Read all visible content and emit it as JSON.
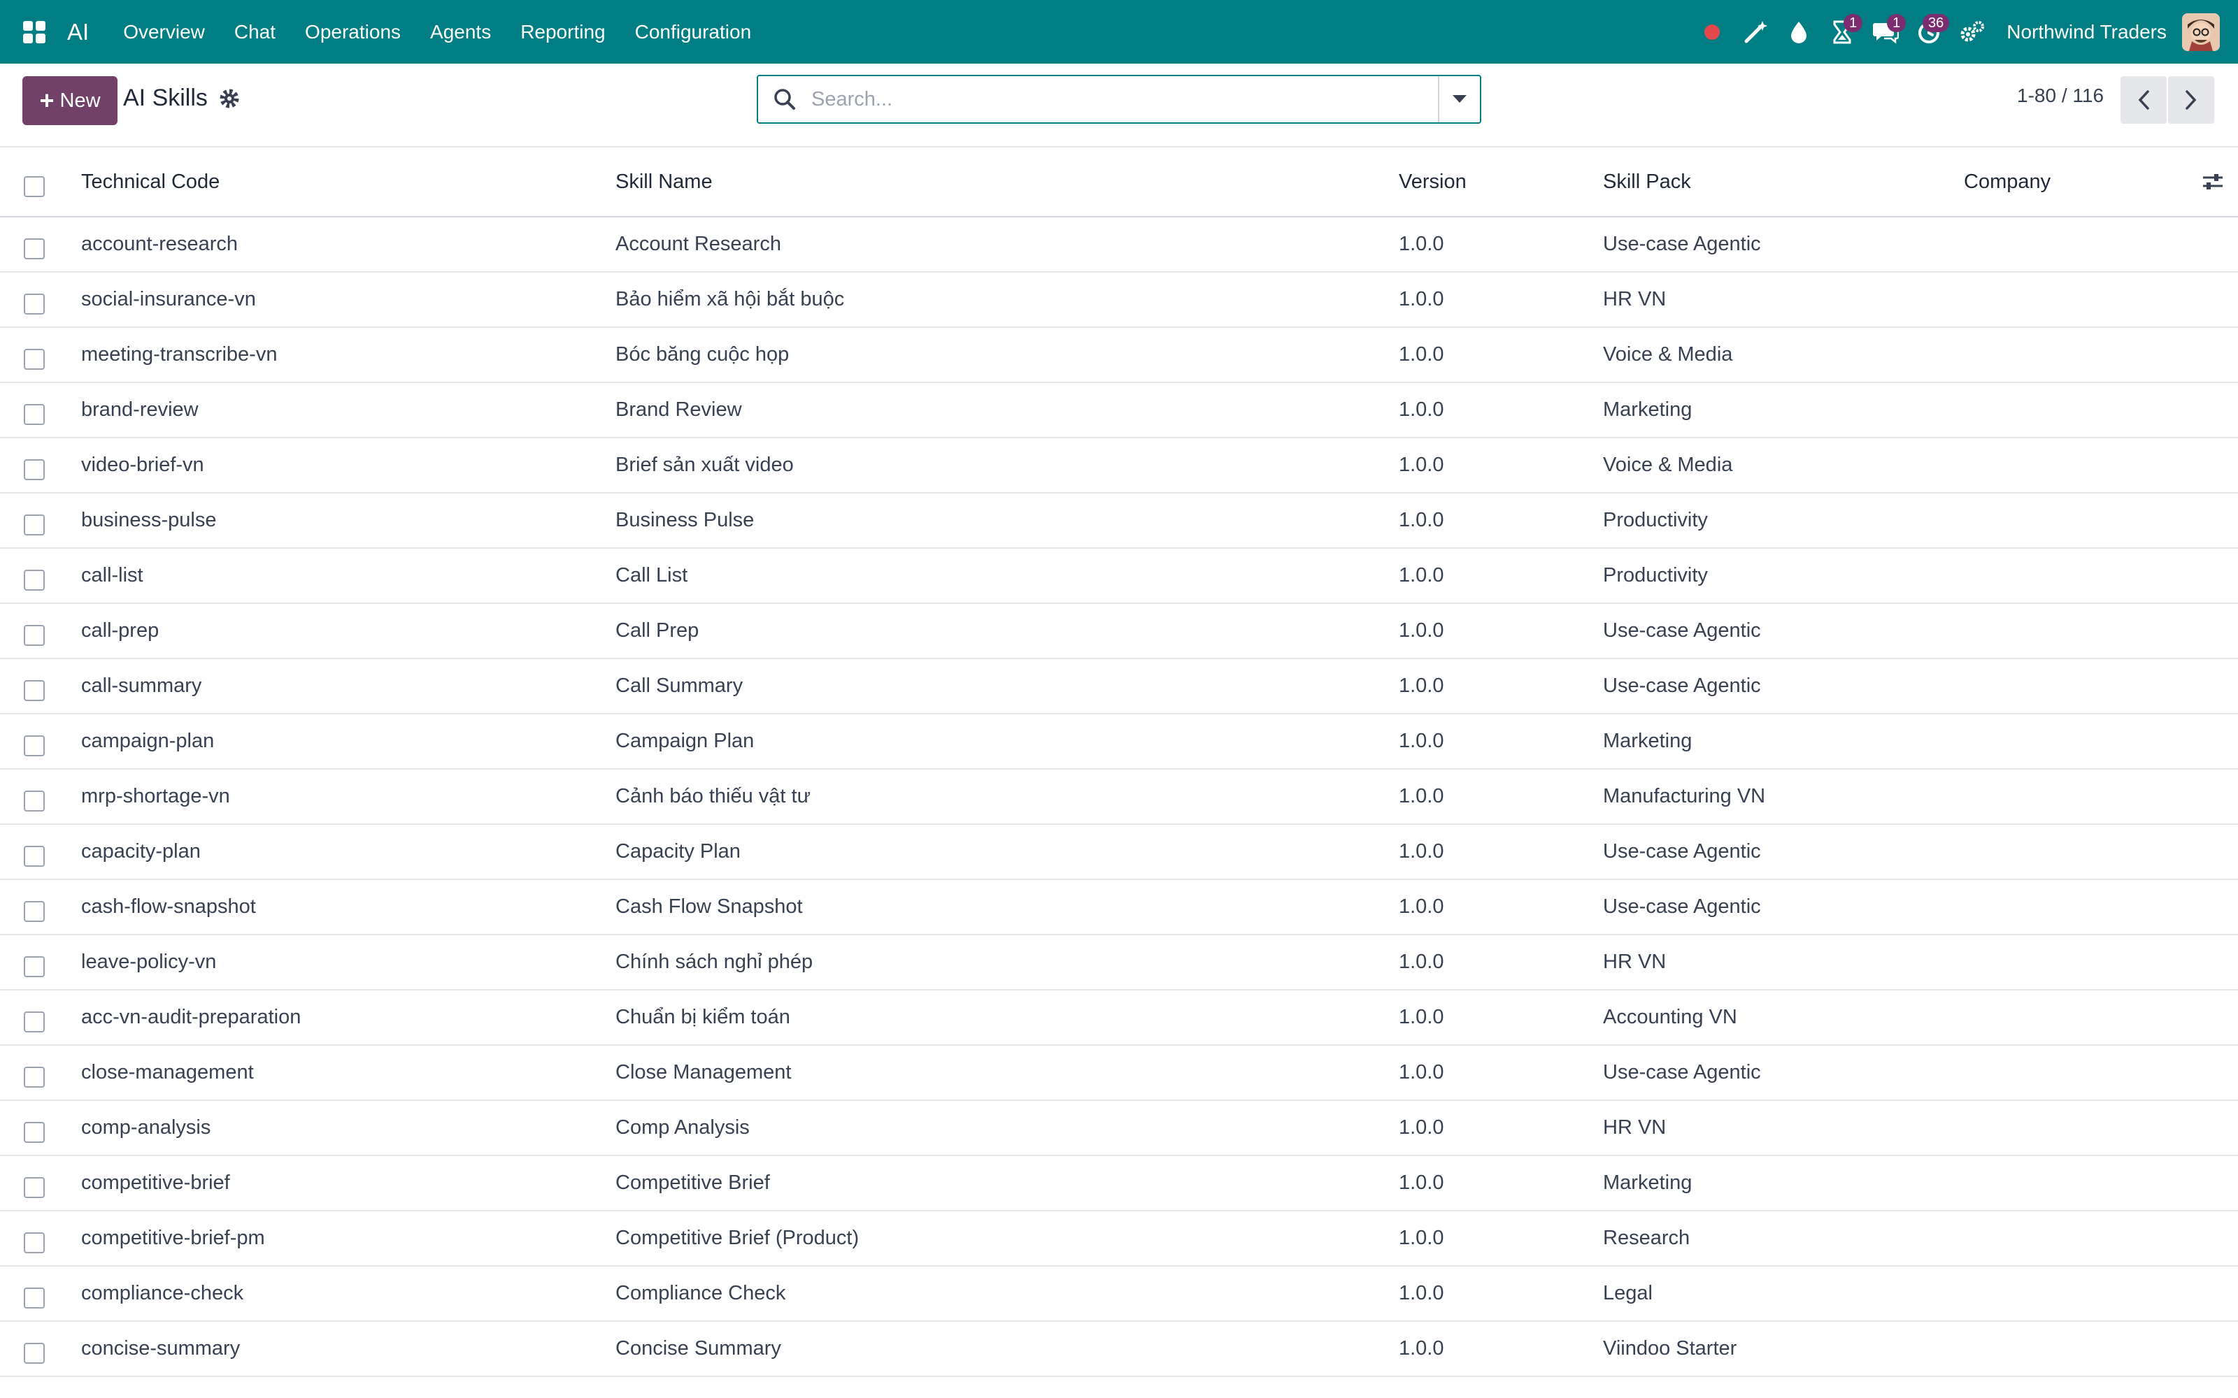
{
  "navbar": {
    "brand": "AI",
    "menu": [
      "Overview",
      "Chat",
      "Operations",
      "Agents",
      "Reporting",
      "Configuration"
    ],
    "activities_badge": "1",
    "messages_badge": "1",
    "timer_badge": "36",
    "company": "Northwind Traders"
  },
  "control": {
    "new_label": "New",
    "title": "AI Skills",
    "search_placeholder": "Search...",
    "pager": "1-80 / 116"
  },
  "table": {
    "headers": {
      "code": "Technical Code",
      "name": "Skill Name",
      "version": "Version",
      "pack": "Skill Pack",
      "company": "Company"
    },
    "rows": [
      {
        "code": "account-research",
        "name": "Account Research",
        "version": "1.0.0",
        "pack": "Use-case Agentic"
      },
      {
        "code": "social-insurance-vn",
        "name": "Bảo hiểm xã hội bắt buộc",
        "version": "1.0.0",
        "pack": "HR VN"
      },
      {
        "code": "meeting-transcribe-vn",
        "name": "Bóc băng cuộc họp",
        "version": "1.0.0",
        "pack": "Voice & Media"
      },
      {
        "code": "brand-review",
        "name": "Brand Review",
        "version": "1.0.0",
        "pack": "Marketing"
      },
      {
        "code": "video-brief-vn",
        "name": "Brief sản xuất video",
        "version": "1.0.0",
        "pack": "Voice & Media"
      },
      {
        "code": "business-pulse",
        "name": "Business Pulse",
        "version": "1.0.0",
        "pack": "Productivity"
      },
      {
        "code": "call-list",
        "name": "Call List",
        "version": "1.0.0",
        "pack": "Productivity"
      },
      {
        "code": "call-prep",
        "name": "Call Prep",
        "version": "1.0.0",
        "pack": "Use-case Agentic"
      },
      {
        "code": "call-summary",
        "name": "Call Summary",
        "version": "1.0.0",
        "pack": "Use-case Agentic"
      },
      {
        "code": "campaign-plan",
        "name": "Campaign Plan",
        "version": "1.0.0",
        "pack": "Marketing"
      },
      {
        "code": "mrp-shortage-vn",
        "name": "Cảnh báo thiếu vật tư",
        "version": "1.0.0",
        "pack": "Manufacturing VN"
      },
      {
        "code": "capacity-plan",
        "name": "Capacity Plan",
        "version": "1.0.0",
        "pack": "Use-case Agentic"
      },
      {
        "code": "cash-flow-snapshot",
        "name": "Cash Flow Snapshot",
        "version": "1.0.0",
        "pack": "Use-case Agentic"
      },
      {
        "code": "leave-policy-vn",
        "name": "Chính sách nghỉ phép",
        "version": "1.0.0",
        "pack": "HR VN"
      },
      {
        "code": "acc-vn-audit-preparation",
        "name": "Chuẩn bị kiểm toán",
        "version": "1.0.0",
        "pack": "Accounting VN"
      },
      {
        "code": "close-management",
        "name": "Close Management",
        "version": "1.0.0",
        "pack": "Use-case Agentic"
      },
      {
        "code": "comp-analysis",
        "name": "Comp Analysis",
        "version": "1.0.0",
        "pack": "HR VN"
      },
      {
        "code": "competitive-brief",
        "name": "Competitive Brief",
        "version": "1.0.0",
        "pack": "Marketing"
      },
      {
        "code": "competitive-brief-pm",
        "name": "Competitive Brief (Product)",
        "version": "1.0.0",
        "pack": "Research"
      },
      {
        "code": "compliance-check",
        "name": "Compliance Check",
        "version": "1.0.0",
        "pack": "Legal"
      },
      {
        "code": "concise-summary",
        "name": "Concise Summary",
        "version": "1.0.0",
        "pack": "Viindoo Starter"
      }
    ]
  }
}
